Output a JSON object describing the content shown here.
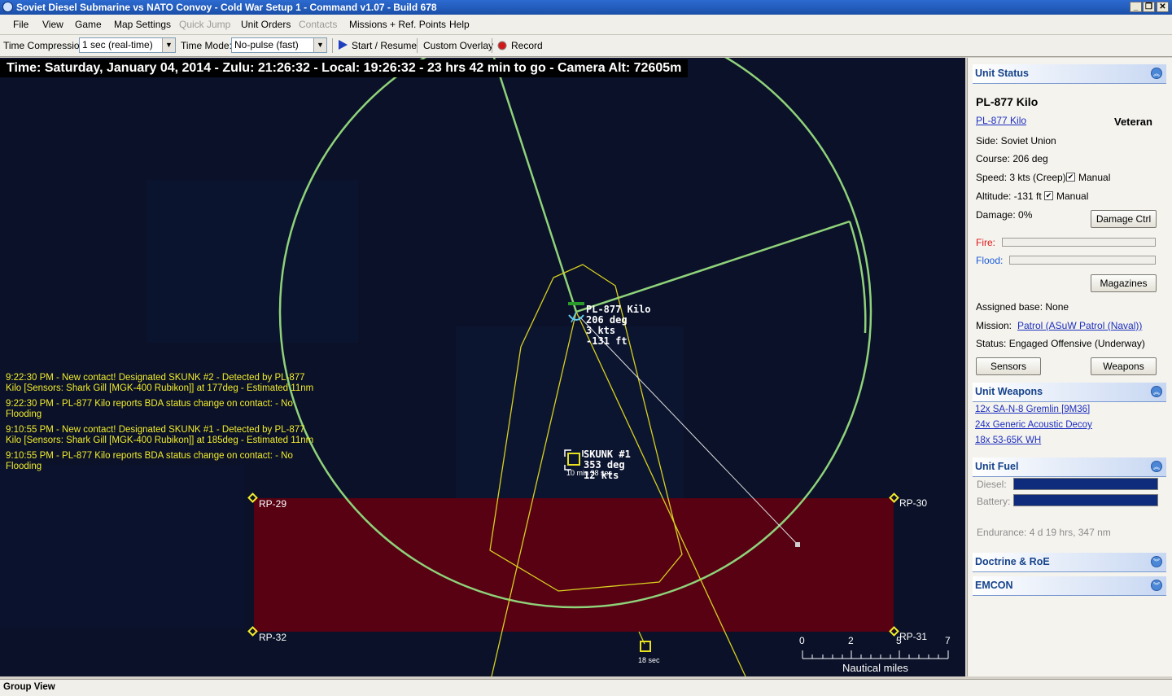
{
  "window": {
    "title": "Soviet Diesel Submarine vs NATO Convoy - Cold War Setup 1 - Command v1.07 - Build 678",
    "minimize": "_",
    "restore": "❐",
    "close": "✕"
  },
  "menu": [
    "File",
    "View",
    "Game",
    "Map Settings",
    "Quick Jump",
    "Unit Orders",
    "Contacts",
    "Missions + Ref. Points",
    "Help"
  ],
  "toolbar": {
    "time_compression_label": "Time Compression:",
    "time_compression_value": "1 sec (real-time)",
    "time_mode_label": "Time Mode:",
    "time_mode_value": "No-pulse (fast)",
    "start_resume": "Start / Resume",
    "custom_overlay": "Custom Overlay",
    "record": "Record"
  },
  "map": {
    "time_header": "Time: Saturday, January 04, 2014 - Zulu: 21:26:32 - Local: 19:26:32 - 23 hrs 42 min to go -  Camera Alt: 72605m",
    "message_log": [
      "9:22:30 PM - New contact! Designated SKUNK #2 - Detected by PL-877 Kilo [Sensors: Shark Gill [MGK-400 Rubikon]] at 177deg - Estimated 11nm",
      "9:22:30 PM - PL-877 Kilo reports BDA status change on contact:  - No Flooding",
      "9:10:55 PM - New contact! Designated SKUNK #1 - Detected by PL-877 Kilo [Sensors: Shark Gill [MGK-400 Rubikon]] at 185deg - Estimated 11nm",
      "9:10:55 PM - PL-877 Kilo reports BDA status change on contact:  - No Flooding"
    ],
    "own_unit": {
      "name": "PL-877 Kilo",
      "heading": "206 deg",
      "speed": "3 kts",
      "depth": "-131 ft"
    },
    "contact": {
      "name": "SKUNK #1",
      "heading": "353 deg",
      "speed": "12 kts",
      "timer": "10 min 38 sec"
    },
    "contact2_timer": "18 sec",
    "ref_points": [
      "RP-29",
      "RP-30",
      "RP-31",
      "RP-32"
    ],
    "scale": {
      "ticks": [
        "0",
        "2",
        "5",
        "7"
      ],
      "unit": "Nautical miles"
    },
    "colors": {
      "background": "#0a1128",
      "range_ring": "#8fd27a",
      "zone_fill": "#5e0010",
      "contact": "#e8e020",
      "ref_point": "#f2ec2c"
    }
  },
  "panel": {
    "unit_status": {
      "header": "Unit Status",
      "unit_name": "PL-877 Kilo",
      "class_link": "PL-877 Kilo",
      "proficiency": "Veteran",
      "side": "Side: Soviet Union",
      "course": "Course: 206 deg",
      "speed": "Speed: 3 kts (Creep)",
      "altitude": "Altitude: -131 ft",
      "manual": "Manual",
      "damage": "Damage: 0%",
      "damage_ctrl": "Damage Ctrl",
      "fire": "Fire:",
      "flood": "Flood:",
      "magazines": "Magazines",
      "assigned_base": "Assigned base: None",
      "mission_label": "Mission:",
      "mission_link": "Patrol (ASuW Patrol (Naval))",
      "status": "Status: Engaged Offensive (Underway)",
      "sensors": "Sensors",
      "weapons": "Weapons"
    },
    "unit_weapons": {
      "header": "Unit Weapons",
      "items": [
        "12x SA-N-8 Gremlin [9M36]",
        "24x Generic Acoustic Decoy",
        "18x 53-65K WH"
      ]
    },
    "unit_fuel": {
      "header": "Unit Fuel",
      "diesel": "Diesel:",
      "battery": "Battery:",
      "diesel_level": 1.0,
      "battery_level": 1.0,
      "endurance": "Endurance: 4 d 19 hrs, 347 nm"
    },
    "doctrine_header": "Doctrine & RoE",
    "emcon_header": "EMCON"
  },
  "statusbar": {
    "text": "Group View"
  }
}
